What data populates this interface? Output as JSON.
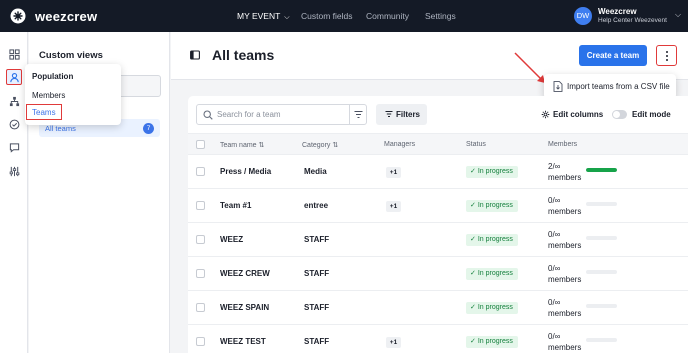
{
  "topbar": {
    "brand": "weezcrew",
    "nav": [
      {
        "label": "MY EVENT",
        "active": true,
        "has_dropdown": true
      },
      {
        "label": "Custom fields",
        "active": false
      },
      {
        "label": "Community",
        "active": false
      },
      {
        "label": "Settings",
        "active": false
      }
    ],
    "user": {
      "initials": "DW",
      "name": "Weezcrew",
      "organization": "Help Center Weezevent"
    }
  },
  "rail": {
    "icons": [
      "dashboard-icon",
      "population-icon",
      "hierarchy-icon",
      "check-circle-icon",
      "message-icon",
      "sliders-icon"
    ],
    "selected": "population-icon"
  },
  "sidebar": {
    "title": "Custom views",
    "all_teams_label": "All teams",
    "all_teams_count": "7"
  },
  "flyout": {
    "title": "Population",
    "items": [
      "Members",
      "Teams"
    ],
    "highlighted": "Teams"
  },
  "main": {
    "title": "All teams",
    "create_button": "Create a team",
    "more_menu": {
      "item": "Import teams from a CSV file"
    }
  },
  "toolbar": {
    "search_placeholder": "Search for a team",
    "filters_label": "Filters",
    "edit_columns_label": "Edit columns",
    "edit_mode_label": "Edit mode",
    "edit_mode_on": false
  },
  "colors": {
    "accent": "#2a73ea",
    "topbar": "#141a26",
    "highlight": "#e03a3a",
    "status_green": "#15803d",
    "progress_green": "#17a34a"
  },
  "table": {
    "columns": [
      "Team name",
      "Category",
      "Managers",
      "Status",
      "Members"
    ],
    "rows": [
      {
        "name": "Press / Media",
        "category": "Media",
        "managers": "+1",
        "status": "In progress",
        "members_count": "2/∞",
        "members_label": "members",
        "fill": 1.0
      },
      {
        "name": "Team #1",
        "category": "entree",
        "managers": "+1",
        "status": "In progress",
        "members_count": "0/∞",
        "members_label": "members",
        "fill": 0
      },
      {
        "name": "WEEZ",
        "category": "STAFF",
        "managers": "",
        "status": "In progress",
        "members_count": "0/∞",
        "members_label": "members",
        "fill": 0
      },
      {
        "name": "WEEZ CREW",
        "category": "STAFF",
        "managers": "",
        "status": "In progress",
        "members_count": "0/∞",
        "members_label": "members",
        "fill": 0
      },
      {
        "name": "WEEZ SPAIN",
        "category": "STAFF",
        "managers": "",
        "status": "In progress",
        "members_count": "0/∞",
        "members_label": "members",
        "fill": 0
      },
      {
        "name": "WEEZ TEST",
        "category": "STAFF",
        "managers": "+1",
        "status": "In progress",
        "members_count": "0/∞",
        "members_label": "members",
        "fill": 0
      }
    ]
  }
}
